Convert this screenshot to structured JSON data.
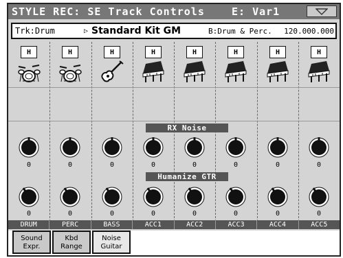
{
  "title": "STYLE REC: SE Track Controls",
  "variation": "E: Var1",
  "menu_icon": "triangle-down-icon",
  "track": {
    "label": "Trk:Drum",
    "kit_name": "Standard Kit GM",
    "kit_group": "B:Drum & Perc.",
    "tempo": "120.000.000"
  },
  "channels": [
    {
      "label": "DRUM",
      "badge": "H",
      "icon": "drumkit-icon",
      "rx_noise": "0",
      "humanize": "0"
    },
    {
      "label": "PERC",
      "badge": "H",
      "icon": "drumkit-icon",
      "rx_noise": "0",
      "humanize": "0"
    },
    {
      "label": "BASS",
      "badge": "H",
      "icon": "guitar-icon",
      "rx_noise": "0",
      "humanize": "0"
    },
    {
      "label": "ACC1",
      "badge": "H",
      "icon": "piano-icon",
      "rx_noise": "0",
      "humanize": "0"
    },
    {
      "label": "ACC2",
      "badge": "H",
      "icon": "piano-icon",
      "rx_noise": "0",
      "humanize": "0"
    },
    {
      "label": "ACC3",
      "badge": "H",
      "icon": "piano-icon",
      "rx_noise": "0",
      "humanize": "0"
    },
    {
      "label": "ACC4",
      "badge": "H",
      "icon": "piano-icon",
      "rx_noise": "0",
      "humanize": "0"
    },
    {
      "label": "ACC5",
      "badge": "H",
      "icon": "piano-icon",
      "rx_noise": "0",
      "humanize": "0"
    }
  ],
  "sections": {
    "rx_noise": "RX Noise",
    "humanize": "Humanize GTR"
  },
  "tabs": [
    {
      "line1": "Sound",
      "line2": "Expr."
    },
    {
      "line1": "Kbd",
      "line2": "Range"
    },
    {
      "line1": "Noise",
      "line2": "Guitar"
    }
  ]
}
